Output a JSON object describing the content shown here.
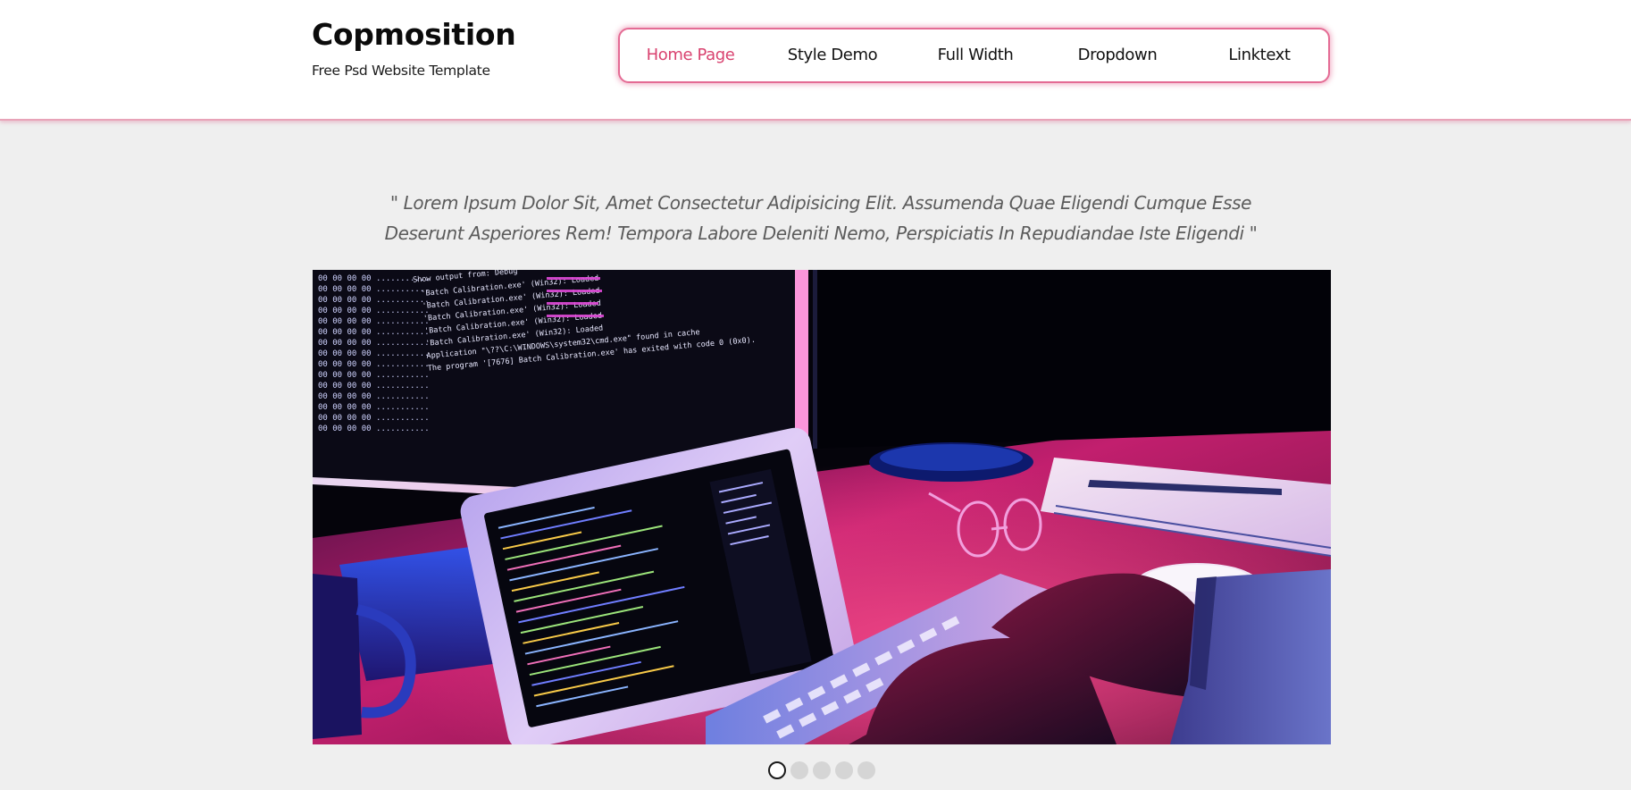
{
  "header": {
    "brand_name": "Copmosition",
    "tagline": "Free Psd Website Template",
    "accent_color": "#d9426f"
  },
  "nav": {
    "items": [
      {
        "label": "Home Page",
        "active": true
      },
      {
        "label": "Style Demo",
        "active": false
      },
      {
        "label": "Full Width",
        "active": false
      },
      {
        "label": "Dropdown",
        "active": false
      },
      {
        "label": "Linktext",
        "active": false
      }
    ]
  },
  "quote": {
    "line1": "\" Lorem Ipsum Dolor Sit, Amet Consectetur Adipisicing Elit. Assumenda Quae Eligendi Cumque Esse",
    "line2": "Deserunt Asperiores Rem! Tempora Labore Deleniti Nemo, Perspiciatis In Repudiandae Iste Eligendi \""
  },
  "slider": {
    "slide_count": 5,
    "active_slide": 1
  },
  "hero_screen_text": {
    "line1": "Show output from: Debug",
    "line2": "'Batch Calibration.exe' (Win32): Loaded",
    "line3": "'Batch Calibration.exe' (Win32): Loaded",
    "line4": "'Batch Calibration.exe' (Win32): Loaded",
    "line5": "'Batch Calibration.exe' (Win32): Loaded",
    "line6": "'Batch Calibration.exe' (Win32): Loaded",
    "line7": "Application \"\\??\\C:\\WINDOWS\\system32\\cmd.exe\" found in cache",
    "line8": "The program '[7676] Batch Calibration.exe' has exited with code 0 (0x0)."
  }
}
